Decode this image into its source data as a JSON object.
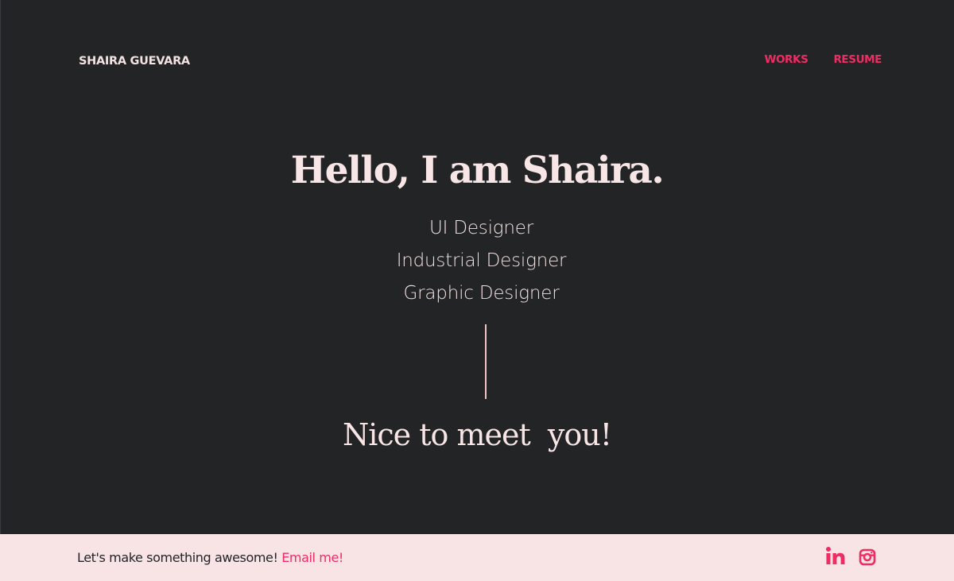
{
  "header": {
    "logo": "SHAIRA GUEVARA",
    "nav": [
      {
        "label": "WORKS"
      },
      {
        "label": "RESUME"
      }
    ]
  },
  "hero": {
    "title": "Hello, I am Shaira.",
    "roles": [
      "UI Designer",
      "Industrial Designer",
      "Graphic Designer"
    ],
    "greeting": "Nice to meet  you!"
  },
  "footer": {
    "tagline": "Let's make something awesome!",
    "email_link": "Email me!",
    "social": [
      {
        "icon": "linkedin-icon"
      },
      {
        "icon": "instagram-icon"
      }
    ]
  },
  "colors": {
    "background": "#232426",
    "accent": "#ef2d64",
    "text_light": "#f8e6e6",
    "footer_bg": "#f8e3e5",
    "divider": "#f0c4c4"
  }
}
